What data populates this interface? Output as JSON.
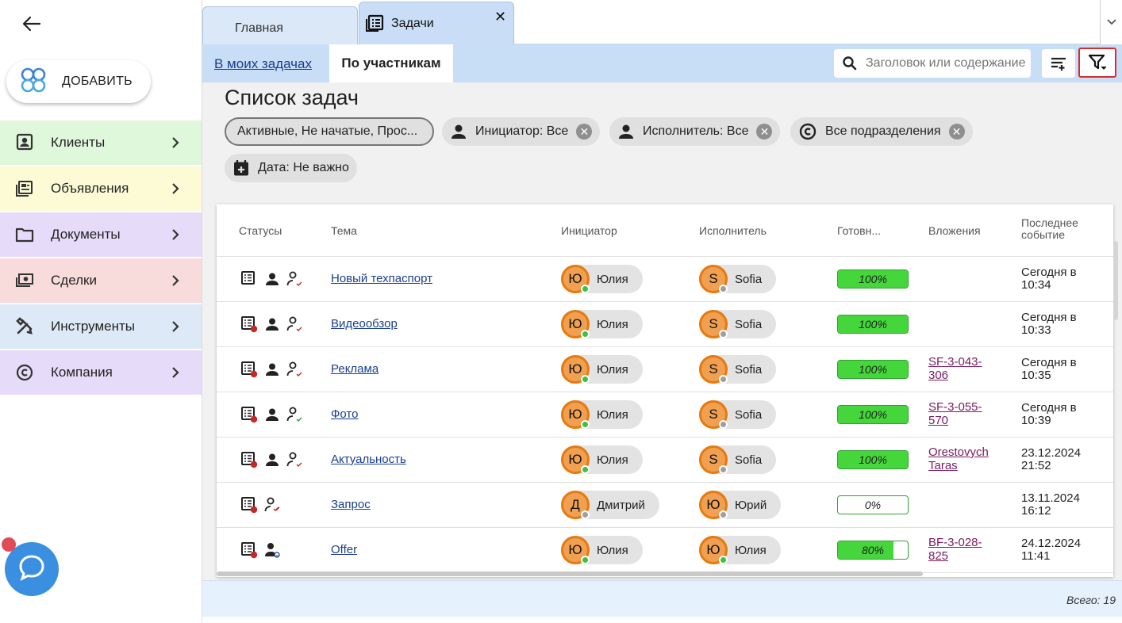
{
  "sidebar": {
    "add_label": "ДОБАВИТЬ",
    "items": [
      {
        "label": "Клиенты",
        "icon": "contacts-icon",
        "bg": "#dff7da"
      },
      {
        "label": "Объявления",
        "icon": "listing-icon",
        "bg": "#fcfbd6"
      },
      {
        "label": "Документы",
        "icon": "folder-icon",
        "bg": "#e6dbf9"
      },
      {
        "label": "Сделки",
        "icon": "money-icon",
        "bg": "#f8dbdb"
      },
      {
        "label": "Инструменты",
        "icon": "tools-icon",
        "bg": "#dde9f7"
      },
      {
        "label": "Компания",
        "icon": "copyright-icon",
        "bg": "#e6dbf9"
      }
    ]
  },
  "tabs": [
    {
      "label": "Главная",
      "active": false
    },
    {
      "label": "Задачи",
      "active": true
    }
  ],
  "subbar": {
    "my_tasks_link": "В моих задачах",
    "by_participants": "По участникам",
    "search_placeholder": "Заголовок или содержание"
  },
  "page": {
    "title": "Список задач",
    "filters": {
      "status": "Активные, Не начатые, Прос...",
      "initiator": "Инициатор: Все",
      "executor": "Исполнитель: Все",
      "departments": "Все подразделения",
      "date": "Дата: Не важно"
    }
  },
  "table": {
    "headers": {
      "statuses": "Статусы",
      "topic": "Тема",
      "initiator": "Инициатор",
      "executor": "Исполнитель",
      "ready": "Готовн...",
      "attachments": "Вложения",
      "last_event_1": "Последнее",
      "last_event_2": "событие"
    },
    "rows": [
      {
        "topic": "Новый техпаспорт",
        "initiator": {
          "initial": "Ю",
          "name": "Юлия",
          "online": true
        },
        "executor": {
          "initial": "S",
          "name": "Sofia",
          "online": false
        },
        "progress": 100,
        "progress_label": "100%",
        "attach_1": "",
        "attach_2": "",
        "event_1": "Сегодня в",
        "event_2": "10:34",
        "overdue": false,
        "person_count": 2,
        "check": "red"
      },
      {
        "topic": "Видеообзор",
        "initiator": {
          "initial": "Ю",
          "name": "Юлия",
          "online": true
        },
        "executor": {
          "initial": "S",
          "name": "Sofia",
          "online": false
        },
        "progress": 100,
        "progress_label": "100%",
        "attach_1": "",
        "attach_2": "",
        "event_1": "Сегодня в",
        "event_2": "10:33",
        "overdue": true,
        "person_count": 2,
        "check": "red"
      },
      {
        "topic": "Реклама",
        "initiator": {
          "initial": "Ю",
          "name": "Юлия",
          "online": true
        },
        "executor": {
          "initial": "S",
          "name": "Sofia",
          "online": false
        },
        "progress": 100,
        "progress_label": "100%",
        "attach_1": "SF-3-043-",
        "attach_2": "306",
        "event_1": "Сегодня в",
        "event_2": "10:35",
        "overdue": true,
        "person_count": 2,
        "check": "red"
      },
      {
        "topic": "Фото",
        "initiator": {
          "initial": "Ю",
          "name": "Юлия",
          "online": true
        },
        "executor": {
          "initial": "S",
          "name": "Sofia",
          "online": false
        },
        "progress": 100,
        "progress_label": "100%",
        "attach_1": "SF-3-055-",
        "attach_2": "570",
        "event_1": "Сегодня в",
        "event_2": "10:39",
        "overdue": true,
        "person_count": 2,
        "check": "green"
      },
      {
        "topic": "Актуальность",
        "initiator": {
          "initial": "Ю",
          "name": "Юлия",
          "online": true
        },
        "executor": {
          "initial": "S",
          "name": "Sofia",
          "online": false
        },
        "progress": 100,
        "progress_label": "100%",
        "attach_1": "Orestovych",
        "attach_2": "Taras",
        "event_1": "23.12.2024",
        "event_2": "21:52",
        "overdue": true,
        "person_count": 2,
        "check": "red"
      },
      {
        "topic": "Запрос",
        "initiator": {
          "initial": "Д",
          "name": "Дмитрий",
          "online": false
        },
        "executor": {
          "initial": "Ю",
          "name": "Юрий",
          "online": false
        },
        "progress": 0,
        "progress_label": "0%",
        "attach_1": "",
        "attach_2": "",
        "event_1": "13.11.2024",
        "event_2": "16:12",
        "overdue": true,
        "person_count": 1,
        "check": "double"
      },
      {
        "topic": "Offer",
        "initiator": {
          "initial": "Ю",
          "name": "Юлия",
          "online": true
        },
        "executor": {
          "initial": "Ю",
          "name": "Юлия",
          "online": true
        },
        "progress": 80,
        "progress_label": "80%",
        "attach_1": "BF-3-028-",
        "attach_2": "825",
        "event_1": "24.12.2024",
        "event_2": "11:41",
        "overdue": true,
        "person_count": 1,
        "check": "smile"
      }
    ]
  },
  "footer": {
    "total": "Всего: 19"
  },
  "colors": {
    "online": "#3fc13f",
    "offline": "#9e9e9e",
    "accent": "#1a3e8c",
    "overdue": "#c62828"
  }
}
